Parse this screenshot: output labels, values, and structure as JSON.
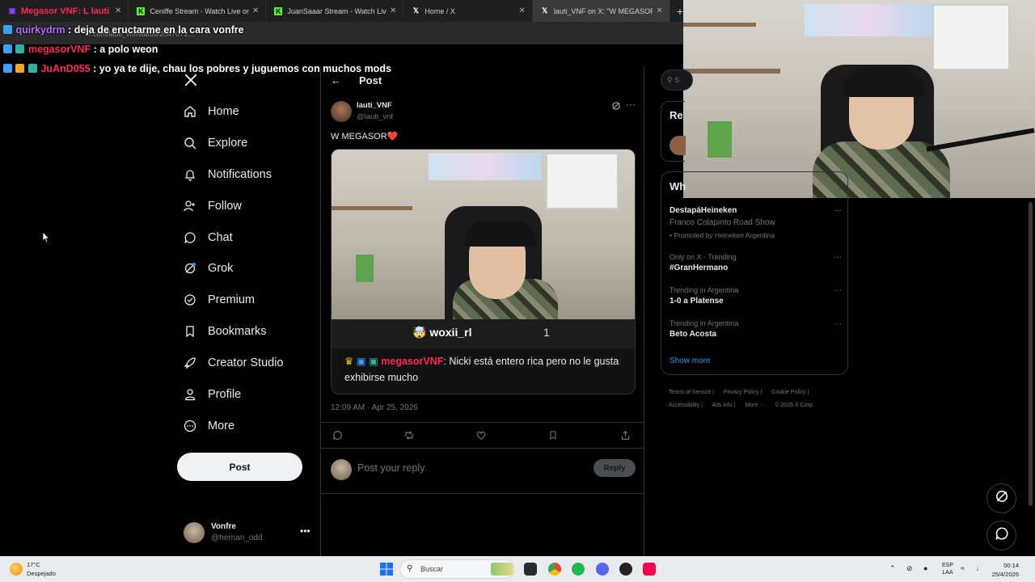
{
  "browser": {
    "tabs": [
      {
        "label": "Megasor VNF: L lauti",
        "active": false
      },
      {
        "label": "Ceniffe Stream - Watch Live on",
        "active": false
      },
      {
        "label": "JuanSaaar Stream - Watch Live",
        "active": false
      },
      {
        "label": "Home / X",
        "active": false
      },
      {
        "label": "lauti_VNF on X: \"W MEGASOR",
        "active": true
      }
    ],
    "new_tab": "+",
    "url_partial": "/.com/lauti_vnf/status/2047073..."
  },
  "chat": [
    {
      "user": "quirkydrm",
      "message": ": deja de eructarme en la cara vonfre",
      "color": "#b46cff"
    },
    {
      "user": "megasorVNF",
      "message": ": a polo weon",
      "color": "#ff2a55"
    },
    {
      "user": "JuAnD055",
      "message": ": yo ya te dije, chau los pobres y juguemos con muchos mods",
      "color": "#ff2a55"
    }
  ],
  "nav": {
    "logo": "X",
    "items": [
      {
        "label": "Home",
        "icon": "home-icon"
      },
      {
        "label": "Explore",
        "icon": "search-icon"
      },
      {
        "label": "Notifications",
        "icon": "bell-icon"
      },
      {
        "label": "Follow",
        "icon": "follow-icon"
      },
      {
        "label": "Chat",
        "icon": "chat-icon"
      },
      {
        "label": "Grok",
        "icon": "grok-icon"
      },
      {
        "label": "Premium",
        "icon": "premium-icon"
      },
      {
        "label": "Bookmarks",
        "icon": "bookmark-icon"
      },
      {
        "label": "Creator Studio",
        "icon": "rocket-icon"
      },
      {
        "label": "Profile",
        "icon": "profile-icon"
      },
      {
        "label": "More",
        "icon": "more-icon"
      }
    ],
    "post_button": "Post",
    "account": {
      "name": "Vonfre",
      "handle": "@hernan_odd",
      "menu": "•••"
    }
  },
  "post_page": {
    "title": "Post",
    "author": {
      "name": "lauti_VNF",
      "handle": "@lauti_vnf"
    },
    "text": "W MEGASOR❤️",
    "media": {
      "viewer_name": "🤯 woxii_rl",
      "viewer_count": "1",
      "chat_user": "megasorVNF",
      "chat_text": ": Nicki está entero rica pero no le gusta exhibirse mucho"
    },
    "timestamp": "12:09 AM · Apr 25, 2026",
    "reply_placeholder": "Post your reply",
    "reply_button": "Reply"
  },
  "sidebar": {
    "search_partial": "S",
    "relevant_partial": "Re",
    "trends_partial": "Wh",
    "trends": [
      {
        "meta": "",
        "name": "DestapáHeineken",
        "sub": "Franco Colapinto Road Show",
        "promo": "Promoted by Heineken Argentina"
      },
      {
        "meta": "Only on X · Trending",
        "name": "#GranHermano",
        "sub": "",
        "promo": ""
      },
      {
        "meta": "Trending in Argentina",
        "name": "1-0 a Platense",
        "sub": "",
        "promo": ""
      },
      {
        "meta": "Trending in Argentina",
        "name": "Beto Acosta",
        "sub": "",
        "promo": ""
      }
    ],
    "show_more": "Show more",
    "footer": [
      "Terms of Service |",
      "Privacy Policy |",
      "Cookie Policy |",
      "Accessibility |",
      "Ads info |",
      "More ···",
      "© 2026 X Corp."
    ]
  },
  "taskbar": {
    "temperature": "17°C",
    "condition": "Despejado",
    "search_label": "Buscar",
    "language_top": "ESP",
    "language_bottom": "LAA",
    "time": "00:14",
    "date": "25/4/2026"
  },
  "colors": {
    "accent": "#1d9bf0",
    "chat_red": "#ff2a55",
    "chat_purple": "#b46cff"
  }
}
